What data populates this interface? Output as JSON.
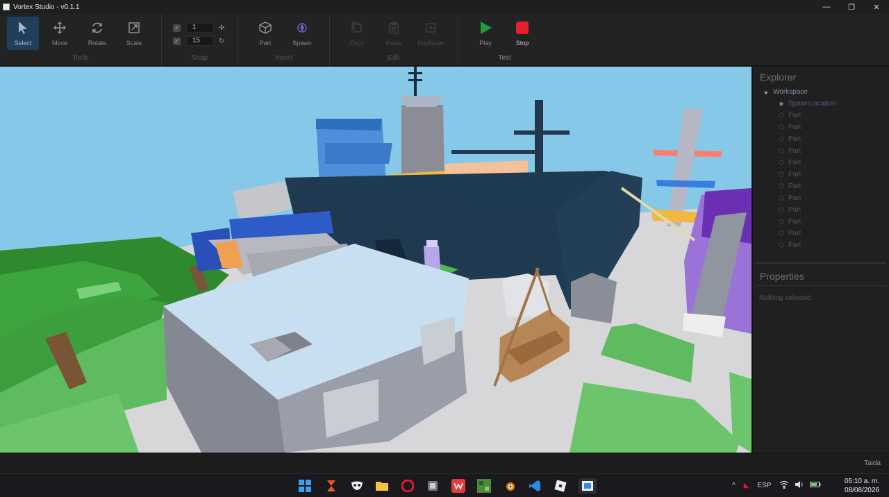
{
  "app": {
    "title": "Vortex Studio - v0.1.1"
  },
  "window_controls": {
    "minimize": "—",
    "maximize": "❐",
    "close": "✕"
  },
  "ribbon": {
    "groups": {
      "tools": "Tools",
      "snap": "Snap",
      "insert": "Insert",
      "edit": "Edit",
      "test": "Test"
    },
    "tools": {
      "select": "Select",
      "move": "Move",
      "rotate": "Rotate",
      "scale": "Scale"
    },
    "snap": {
      "move_value": "1",
      "rotate_value": "15",
      "move_checked": "✓",
      "rotate_checked": "✓"
    },
    "insert": {
      "part": "Part",
      "spawn": "Spawn"
    },
    "edit": {
      "copy": "Copy",
      "paste": "Paste",
      "duplicate": "Duplicate"
    },
    "test": {
      "play": "Play",
      "stop": "Stop"
    },
    "colors": {
      "active_tool_bg": "#1f3f5a",
      "play": "#1e9e3a",
      "stop": "#e5202a"
    }
  },
  "explorer": {
    "title": "Explorer",
    "root": "Workspace",
    "children": [
      "SpawnLocation",
      "Part",
      "Part",
      "Part",
      "Part",
      "Part",
      "Part",
      "Part",
      "Part",
      "Part",
      "Part",
      "Part",
      "Part"
    ]
  },
  "properties": {
    "title": "Properties",
    "empty_text": "Nothing selected"
  },
  "statusbar": {
    "user": "Taida"
  },
  "taskbar": {
    "tray_language": "ESP",
    "time": "05:10 a. m.",
    "date": "08/08/2026",
    "tray_chevron": "^"
  }
}
